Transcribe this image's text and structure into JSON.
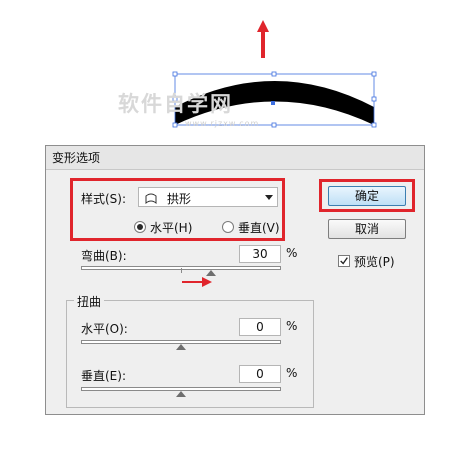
{
  "dialog": {
    "title": "变形选项",
    "style_label": "样式(S):",
    "style_value": "拱形",
    "orientation": {
      "horizontal_label": "水平(H)",
      "vertical_label": "垂直(V)",
      "selected": "horizontal"
    },
    "bend": {
      "label": "弯曲(B):",
      "value": "30",
      "unit": "%"
    },
    "distortion": {
      "title": "扭曲",
      "horizontal": {
        "label": "水平(O):",
        "value": "0",
        "unit": "%"
      },
      "vertical": {
        "label": "垂直(E):",
        "value": "0",
        "unit": "%"
      }
    },
    "ok_label": "确定",
    "cancel_label": "取消",
    "preview": {
      "label": "预览(P)",
      "checked": true
    }
  },
  "watermark": {
    "text": "软件自学网",
    "sub": "www.rjzxw.com"
  },
  "colors": {
    "highlight_red": "#e0252c",
    "selection_blue": "#3d6fe0",
    "default_button": "#bfe0f6"
  }
}
